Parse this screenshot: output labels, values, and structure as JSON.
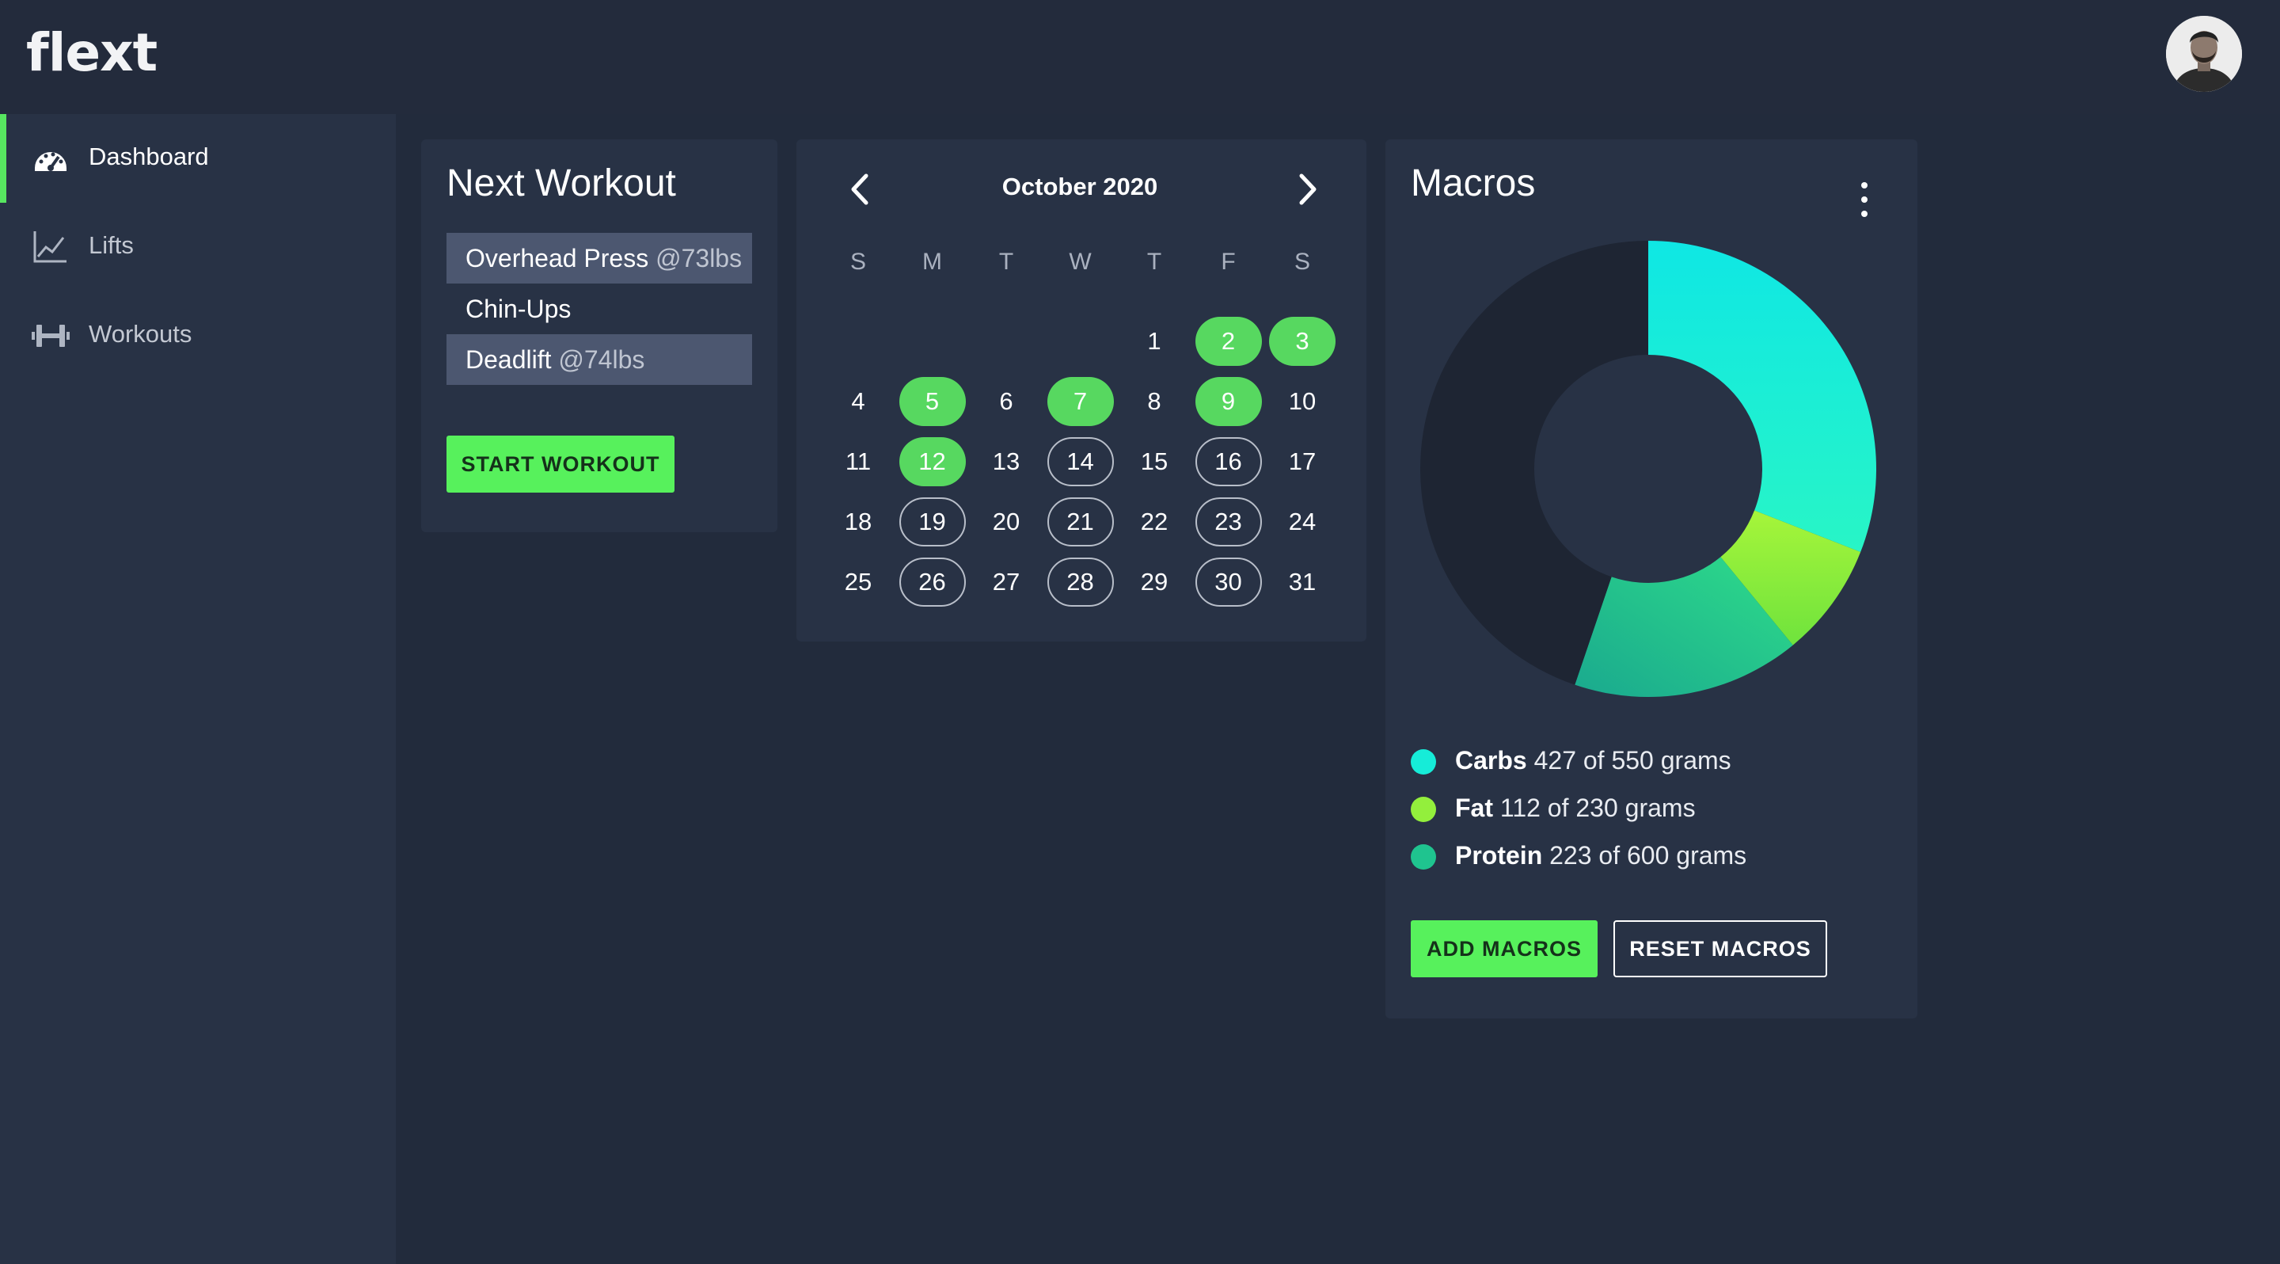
{
  "app": {
    "logo": "flext"
  },
  "sidebar": {
    "items": [
      {
        "label": "Dashboard",
        "icon": "speedometer-icon",
        "active": true
      },
      {
        "label": "Lifts",
        "icon": "line-chart-icon",
        "active": false
      },
      {
        "label": "Workouts",
        "icon": "dumbbell-icon",
        "active": false
      }
    ]
  },
  "next_workout": {
    "title": "Next Workout",
    "exercises": [
      {
        "name": "Overhead Press",
        "weight": "@73lbs",
        "highlighted": true
      },
      {
        "name": "Chin-Ups",
        "weight": "",
        "highlighted": false
      },
      {
        "name": "Deadlift",
        "weight": "@74lbs",
        "highlighted": true
      }
    ],
    "start_label": "START WORKOUT"
  },
  "calendar": {
    "month": "October 2020",
    "weekdays": [
      "S",
      "M",
      "T",
      "W",
      "T",
      "F",
      "S"
    ],
    "first_weekday": 4,
    "days_in_month": 31,
    "completed_days": [
      2,
      3,
      5,
      7,
      9,
      12
    ],
    "planned_days": [
      14,
      16,
      19,
      21,
      23,
      26,
      28,
      30
    ]
  },
  "macros": {
    "title": "Macros",
    "items": [
      {
        "name": "Carbs",
        "detail": "427 of 550 grams",
        "current": 427,
        "goal": 550,
        "color": "#16ecd8"
      },
      {
        "name": "Fat",
        "detail": "112 of 230 grams",
        "current": 112,
        "goal": 230,
        "color": "#93ef3c"
      },
      {
        "name": "Protein",
        "detail": "223 of 600 grams",
        "current": 223,
        "goal": 600,
        "color": "#1fc48f"
      }
    ],
    "remainder_color": "#1e2533",
    "add_label": "ADD MACROS",
    "reset_label": "RESET MACROS"
  },
  "colors": {
    "accent": "#57f15c",
    "background": "#222b3c",
    "panel": "#283245"
  }
}
